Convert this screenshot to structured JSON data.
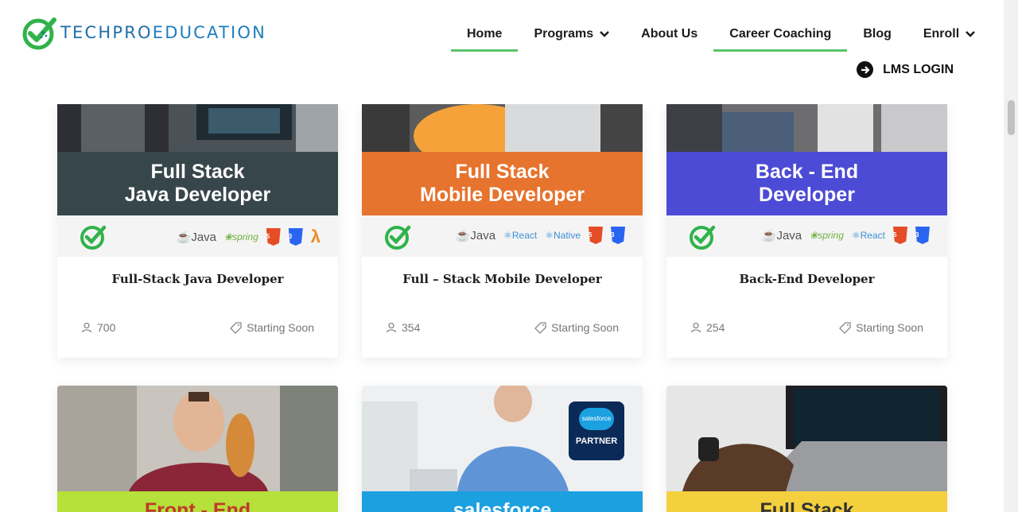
{
  "brand": {
    "name_part1": "TECHPRO",
    "name_part2": "EDUCATION"
  },
  "nav": {
    "items": [
      {
        "label": "Home",
        "active": true,
        "dropdown": false
      },
      {
        "label": "Programs",
        "active": false,
        "dropdown": true
      },
      {
        "label": "About Us",
        "active": false,
        "dropdown": false
      },
      {
        "label": "Career Coaching",
        "active": true,
        "dropdown": false
      },
      {
        "label": "Blog",
        "active": false,
        "dropdown": false
      },
      {
        "label": "Enroll",
        "active": false,
        "dropdown": true
      }
    ],
    "lms_login": "LMS LOGIN"
  },
  "courses": [
    {
      "banner_line1": "Full Stack",
      "banner_line2": "Java Developer",
      "banner_color": "#37464a",
      "tech": [
        "Java",
        "spring",
        "HTML",
        "CSS",
        "LAMBDA"
      ],
      "title": "Full-Stack Java Developer",
      "students": "700",
      "status": "Starting Soon"
    },
    {
      "banner_line1": "Full Stack",
      "banner_line2": "Mobile Developer",
      "banner_color": "#e6732e",
      "tech": [
        "Java",
        "React",
        "Native",
        "HTML",
        "CSS"
      ],
      "title": "Full – Stack Mobile Developer",
      "students": "354",
      "status": "Starting Soon"
    },
    {
      "banner_line1": "Back - End",
      "banner_line2": "Developer",
      "banner_color": "#4b4bd6",
      "tech": [
        "Java",
        "spring",
        "React",
        "HTML",
        "CSS"
      ],
      "title": "Back-End Developer",
      "students": "254",
      "status": "Starting Soon"
    }
  ],
  "courses_row2": [
    {
      "banner_text": "Front - End",
      "banner_color": "#b6e03a",
      "text_color": "#c0392b"
    },
    {
      "banner_text": "salesforce",
      "banner_color": "#1ba0e0",
      "text_color": "#ffffff",
      "badge_top": "salesforce",
      "badge_bottom": "PARTNER"
    },
    {
      "banner_text": "Full Stack",
      "banner_color": "#f4d03f",
      "text_color": "#333333"
    }
  ],
  "colors": {
    "accent_green": "#5cc36a",
    "brand_blue": "#1f6fa8"
  }
}
